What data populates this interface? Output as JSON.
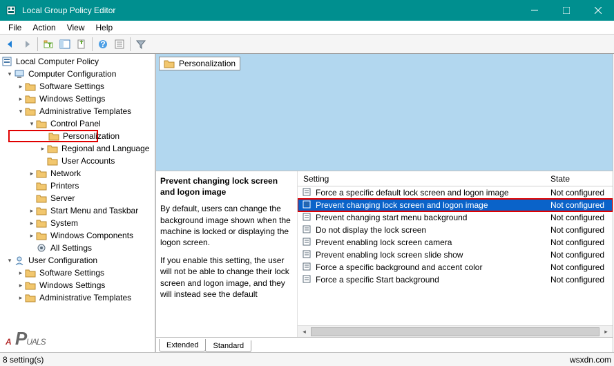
{
  "window": {
    "title": "Local Group Policy Editor"
  },
  "menu": {
    "file": "File",
    "action": "Action",
    "view": "View",
    "help": "Help"
  },
  "tree": {
    "root": "Local Computer Policy",
    "cc": "Computer Configuration",
    "ss": "Software Settings",
    "ws": "Windows Settings",
    "at": "Administrative Templates",
    "cp": "Control Panel",
    "pers": "Personalization",
    "regional": "Regional and Language",
    "ua": "User Accounts",
    "network": "Network",
    "printers": "Printers",
    "server": "Server",
    "smt": "Start Menu and Taskbar",
    "system": "System",
    "wc": "Windows Components",
    "allset": "All Settings",
    "uconf": "User Configuration",
    "uss": "Software Settings",
    "uws": "Windows Settings",
    "uat": "Administrative Templates"
  },
  "preview": {
    "folder": "Personalization"
  },
  "desc": {
    "title": "Prevent changing lock screen and logon image",
    "p1": "By default, users can change the background image shown when the machine is locked or displaying the logon screen.",
    "p2": "If you enable this setting, the user will not be able to change their lock screen and logon image, and they will instead see the default"
  },
  "columns": {
    "setting": "Setting",
    "state": "State"
  },
  "rows": [
    {
      "name": "Force a specific default lock screen and logon image",
      "state": "Not configured",
      "selected": false
    },
    {
      "name": "Prevent changing lock screen and logon image",
      "state": "Not configured",
      "selected": true
    },
    {
      "name": "Prevent changing start menu background",
      "state": "Not configured",
      "selected": false
    },
    {
      "name": "Do not display the lock screen",
      "state": "Not configured",
      "selected": false
    },
    {
      "name": "Prevent enabling lock screen camera",
      "state": "Not configured",
      "selected": false
    },
    {
      "name": "Prevent enabling lock screen slide show",
      "state": "Not configured",
      "selected": false
    },
    {
      "name": "Force a specific background and accent color",
      "state": "Not configured",
      "selected": false
    },
    {
      "name": "Force a specific Start background",
      "state": "Not configured",
      "selected": false
    }
  ],
  "tabs": {
    "extended": "Extended",
    "standard": "Standard"
  },
  "status": {
    "count": "8 setting(s)",
    "credit": "wsxdn.com"
  }
}
